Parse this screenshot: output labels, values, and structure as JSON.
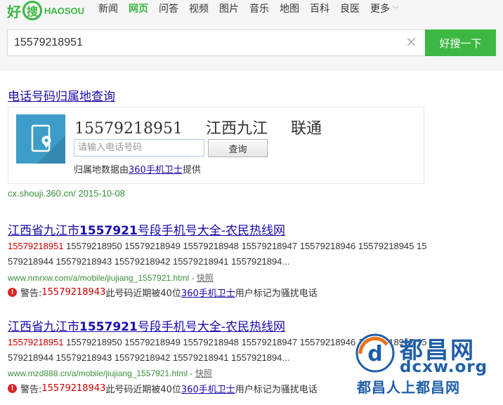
{
  "header": {
    "logo": {
      "left": "好",
      "mid": "搜",
      "right": "HAOSOU"
    },
    "nav": [
      {
        "label": "新闻",
        "active": false
      },
      {
        "label": "网页",
        "active": true
      },
      {
        "label": "问答",
        "active": false
      },
      {
        "label": "视频",
        "active": false
      },
      {
        "label": "图片",
        "active": false
      },
      {
        "label": "音乐",
        "active": false
      },
      {
        "label": "地图",
        "active": false
      },
      {
        "label": "百科",
        "active": false
      },
      {
        "label": "良医",
        "active": false
      },
      {
        "label": "更多",
        "active": false
      }
    ],
    "search": {
      "value": "15579218951",
      "button": "好搜一下",
      "clear_icon": "close-icon"
    }
  },
  "phone_card": {
    "title": "电话号码归属地查询",
    "number": "15579218951",
    "region": "江西九江",
    "carrier": "联通",
    "input_placeholder": "请输入电话号码",
    "query_button": "查询",
    "source_prefix": "归属地数据由",
    "source_link": "360手机卫士",
    "source_suffix": "提供",
    "url": "cx.shouji.360.cn/ 2015-10-08",
    "icon": "phone-location-icon",
    "icon_color": "#3c9dc8"
  },
  "results": [
    {
      "title_pre": "江西省九江市",
      "title_bold": "1557921",
      "title_post": "号段手机号大全-农民热线网",
      "snippet_hl": "15579218951",
      "snippet_rest": " 15579218950 15579218949 15579218948 15579218947 15579218946 15579218945 15579218944 15579218943 15579218942 15579218941 1557921894...",
      "url": "www.nmrxw.com/a/mobile/jiujiang_1557921.html - ",
      "cache": "快照",
      "warn_label": "警告:",
      "warn_number": "15579218943",
      "warn_mid": "此号码近期被40位",
      "warn_link": "360手机卫士",
      "warn_end": "用户标记为骚扰电话"
    },
    {
      "title_pre": "江西省九江市",
      "title_bold": "1557921",
      "title_post": "号段手机号大全-农民热线网",
      "snippet_hl": "15579218951",
      "snippet_rest": " 15579218950 15579218949 15579218948 15579218947 15579218946 15579218945 15579218944 15579218943 15579218942 15579218941 1557921894...",
      "url": "www.mzd888.cn/a/mobile/jiujiang_1557921.html - ",
      "cache": "快照",
      "warn_label": "警告:",
      "warn_number": "15579218943",
      "warn_mid": "此号码近期被40位",
      "warn_link": "360手机卫士",
      "warn_end": "用户标记为骚扰电话"
    }
  ],
  "watermark": {
    "name_cn": "都昌网",
    "domain": "dcxw.org",
    "slogan": "都昌人上都昌网"
  },
  "colors": {
    "brand_green": "#3db843",
    "link_blue": "#1a0dab",
    "highlight_red": "#cc0000",
    "url_green": "#3a8f3a"
  }
}
